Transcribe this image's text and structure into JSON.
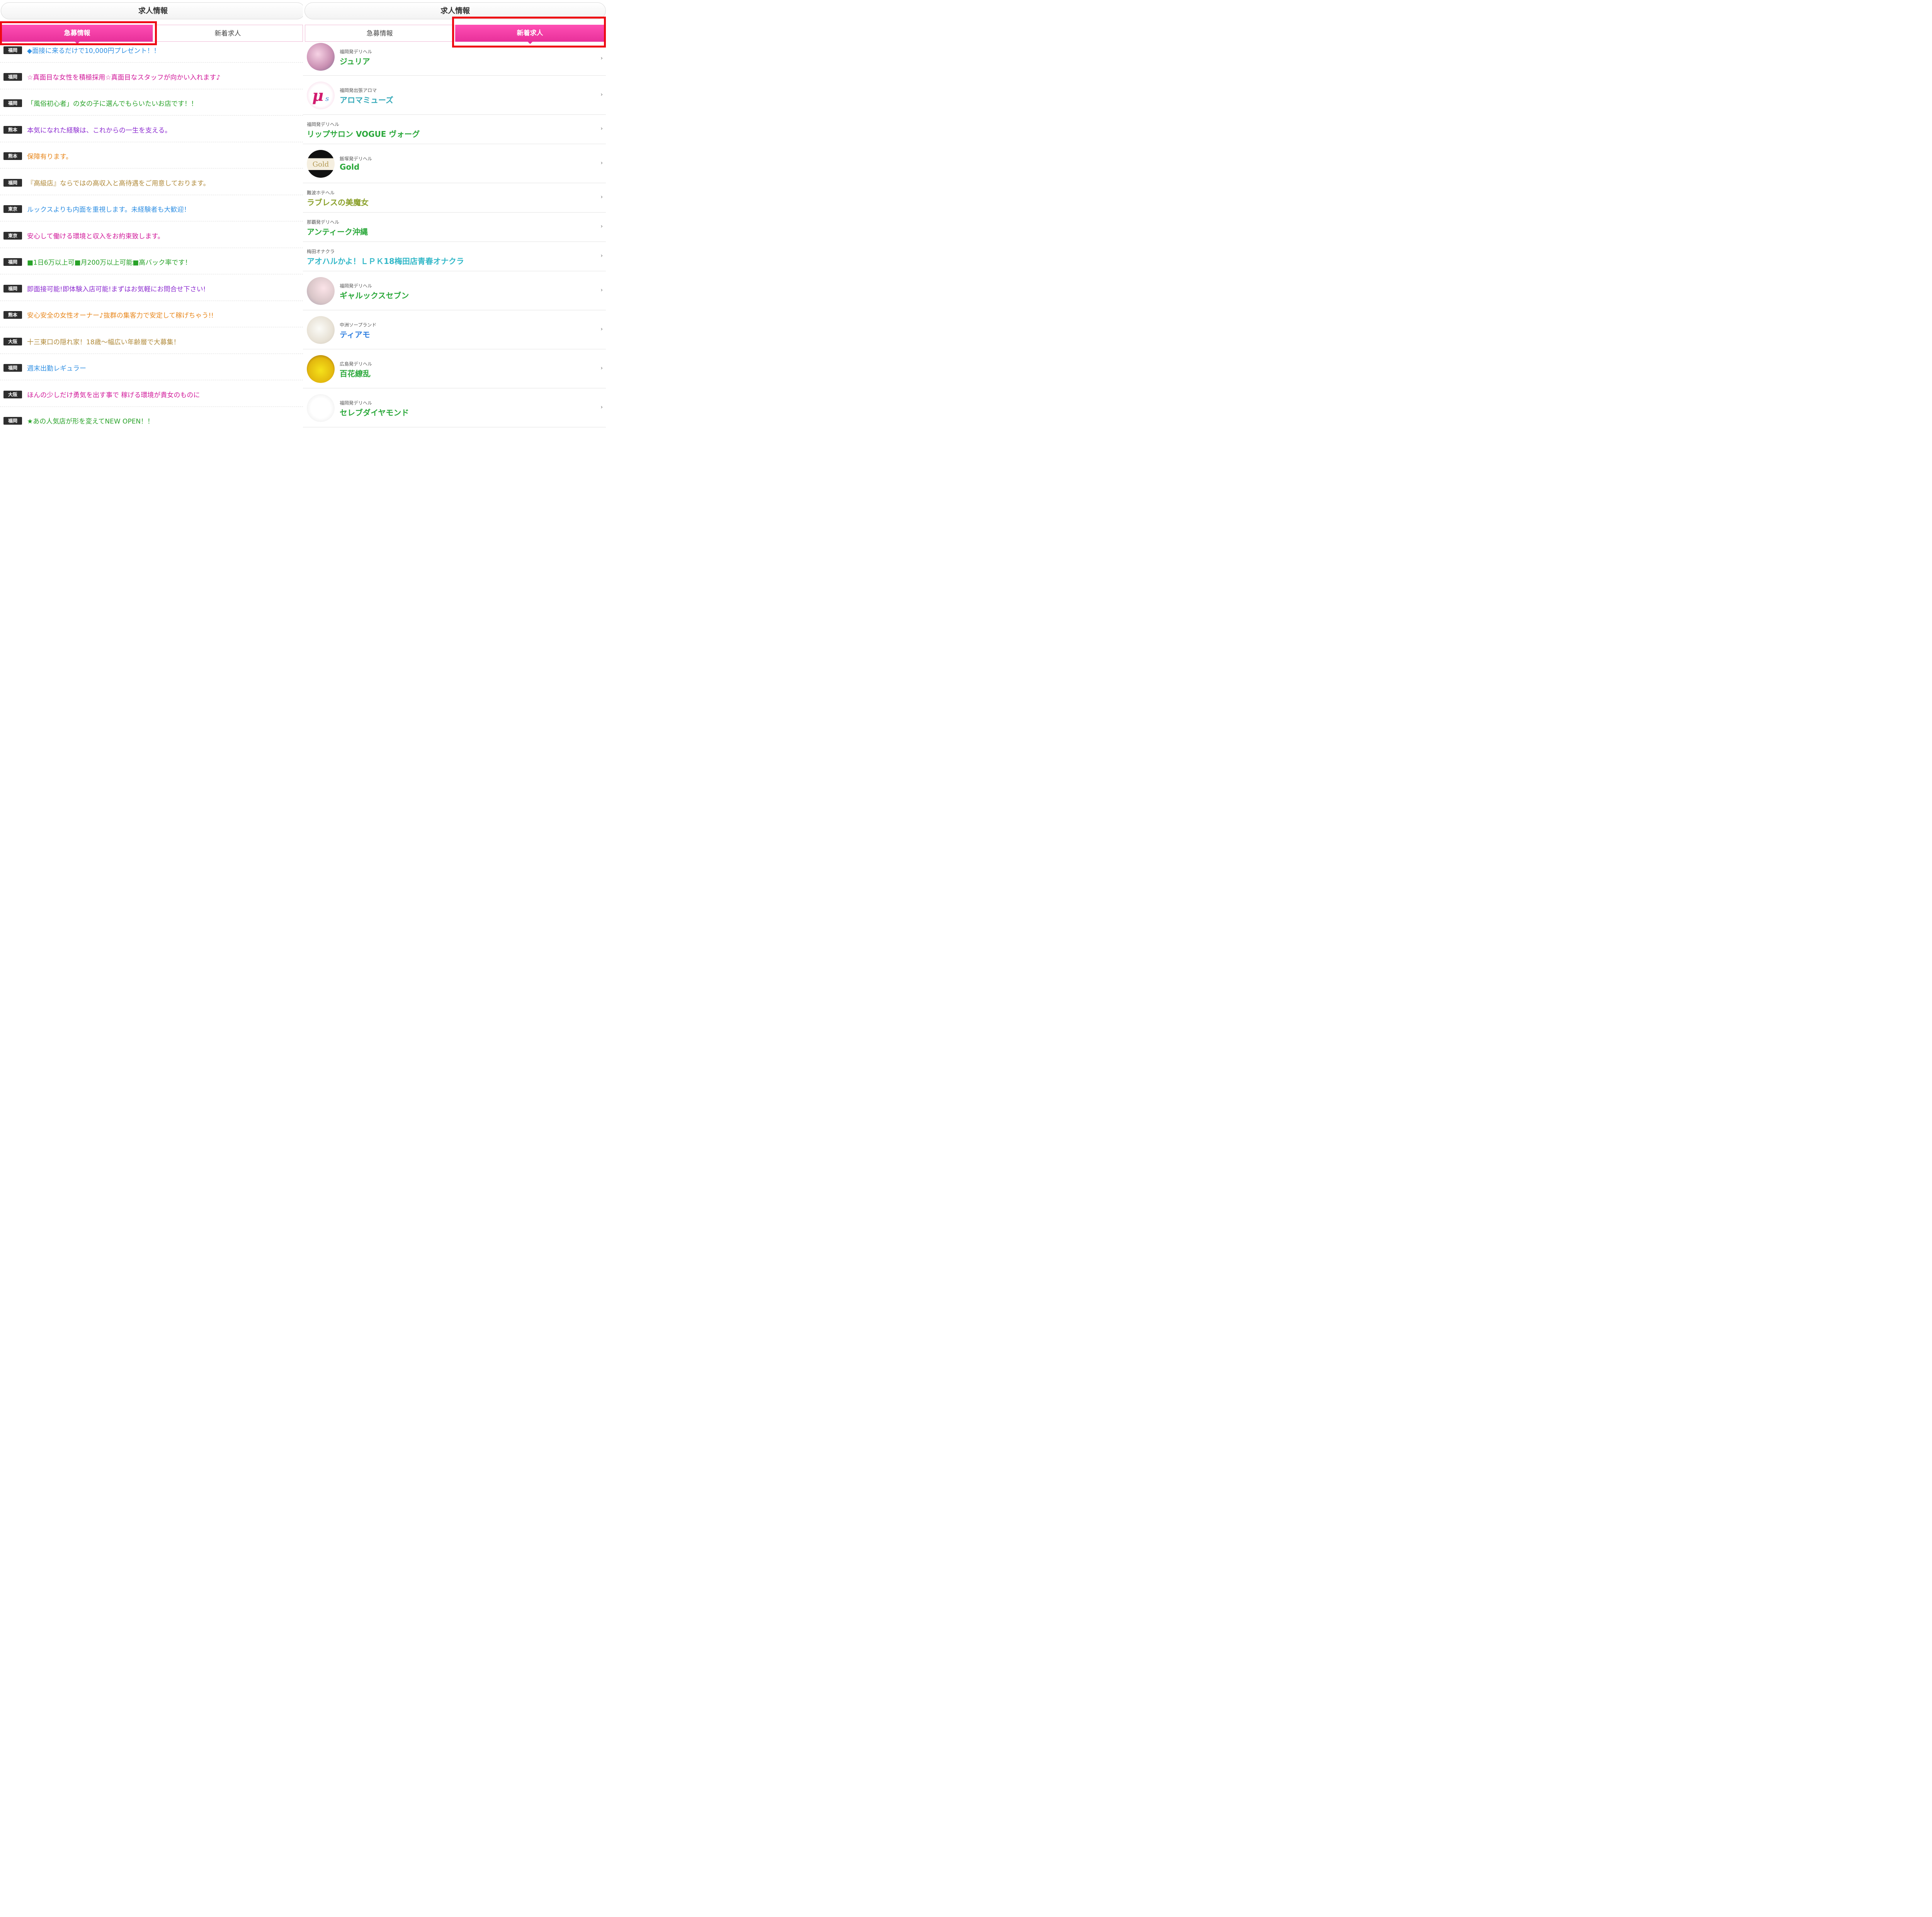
{
  "left_panel": {
    "title": "求人情報",
    "tabs": [
      {
        "label": "急募情報",
        "active": true
      },
      {
        "label": "新着求人",
        "active": false
      }
    ],
    "jobs": [
      {
        "region": "福岡",
        "text": "◆面接に来るだけで10,000円プレゼント！！",
        "color": "#2f8fe3"
      },
      {
        "region": "福岡",
        "text": "☆真面目な女性を積極採用☆真面目なスタッフが向かい入れます♪",
        "color": "#d1199a"
      },
      {
        "region": "福岡",
        "text": "「風俗初心者」の女の子に選んでもらいたいお店です！！",
        "color": "#28a228"
      },
      {
        "region": "熊本",
        "text": "本気になれた経験は、これからの一生を支える。",
        "color": "#8c2cd0"
      },
      {
        "region": "熊本",
        "text": "保障有ります。",
        "color": "#e8861a"
      },
      {
        "region": "福岡",
        "text": "『高級店』ならではの高収入と高待遇をご用意しております。",
        "color": "#b08a3a"
      },
      {
        "region": "東京",
        "text": "ルックスよりも内面を重視します。未経験者も大歓迎！",
        "color": "#2f8fe3"
      },
      {
        "region": "東京",
        "text": "安心して働ける環境と収入をお約束致します。",
        "color": "#d1199a"
      },
      {
        "region": "福岡",
        "text": "■1日6万以上可■月200万以上可能■高バック率です！",
        "color": "#28a228"
      },
      {
        "region": "福岡",
        "text": "即面接可能!即体験入店可能!まずはお気軽にお問合せ下さい!",
        "color": "#8c2cd0"
      },
      {
        "region": "熊本",
        "text": "安心安全の女性オーナー♪抜群の集客力で安定して稼げちゃう!!",
        "color": "#e8861a"
      },
      {
        "region": "大阪",
        "text": "十三東口の隠れ家！18歳～幅広い年齢層で大募集！",
        "color": "#b08a3a"
      },
      {
        "region": "福岡",
        "text": "週末出勤レギュラー",
        "color": "#2f8fe3"
      },
      {
        "region": "大阪",
        "text": "ほんの少しだけ勇気を出す事で 稼げる環境が貴女のものに",
        "color": "#d1199a"
      },
      {
        "region": "福岡",
        "text": "★あの人気店が形を変えてNEW OPEN！！",
        "color": "#28a228"
      }
    ]
  },
  "right_panel": {
    "title": "求人情報",
    "tabs": [
      {
        "label": "急募情報",
        "active": false
      },
      {
        "label": "新着求人",
        "active": true
      }
    ],
    "shops": [
      {
        "category": "福岡発デリヘル",
        "name": "ジュリア",
        "color": "#2aa83a",
        "thumb": true,
        "thumb_style": "photo-pink"
      },
      {
        "category": "福岡発出張アロマ",
        "name": "アロマミューズ",
        "color": "#33a8b8",
        "thumb": true,
        "thumb_style": "logo-mus"
      },
      {
        "category": "福岡発デリヘル",
        "name": "リップサロン VOGUE ヴォーグ",
        "color": "#2aa83a",
        "thumb": false
      },
      {
        "category": "飯塚発デリヘル",
        "name": "Gold",
        "color": "#2aa83a",
        "thumb": true,
        "thumb_style": "logo-gold"
      },
      {
        "category": "難波ホテヘル",
        "name": "ラブレスの美魔女",
        "color": "#8aa02a",
        "thumb": false
      },
      {
        "category": "那覇発デリヘル",
        "name": "アンティーク沖縄",
        "color": "#2aa83a",
        "thumb": false
      },
      {
        "category": "梅田オナクラ",
        "name": "アオハルかよ！ＬＰＫ18梅田店青春オナクラ",
        "color": "#33b8c8",
        "thumb": false
      },
      {
        "category": "福岡発デリヘル",
        "name": "ギャルックスセブン",
        "color": "#2aa83a",
        "thumb": true,
        "thumb_style": "photo-light"
      },
      {
        "category": "中洲ソープランド",
        "name": "ティアモ",
        "color": "#2f7fe0",
        "thumb": true,
        "thumb_style": "photo-pale"
      },
      {
        "category": "広島発デリヘル",
        "name": "百花繚乱",
        "color": "#2aa83a",
        "thumb": true,
        "thumb_style": "logo-yellow"
      },
      {
        "category": "福岡発デリヘル",
        "name": "セレブダイヤモンド",
        "color": "#2aa83a",
        "thumb": true,
        "thumb_style": "logo-celeb"
      }
    ]
  }
}
